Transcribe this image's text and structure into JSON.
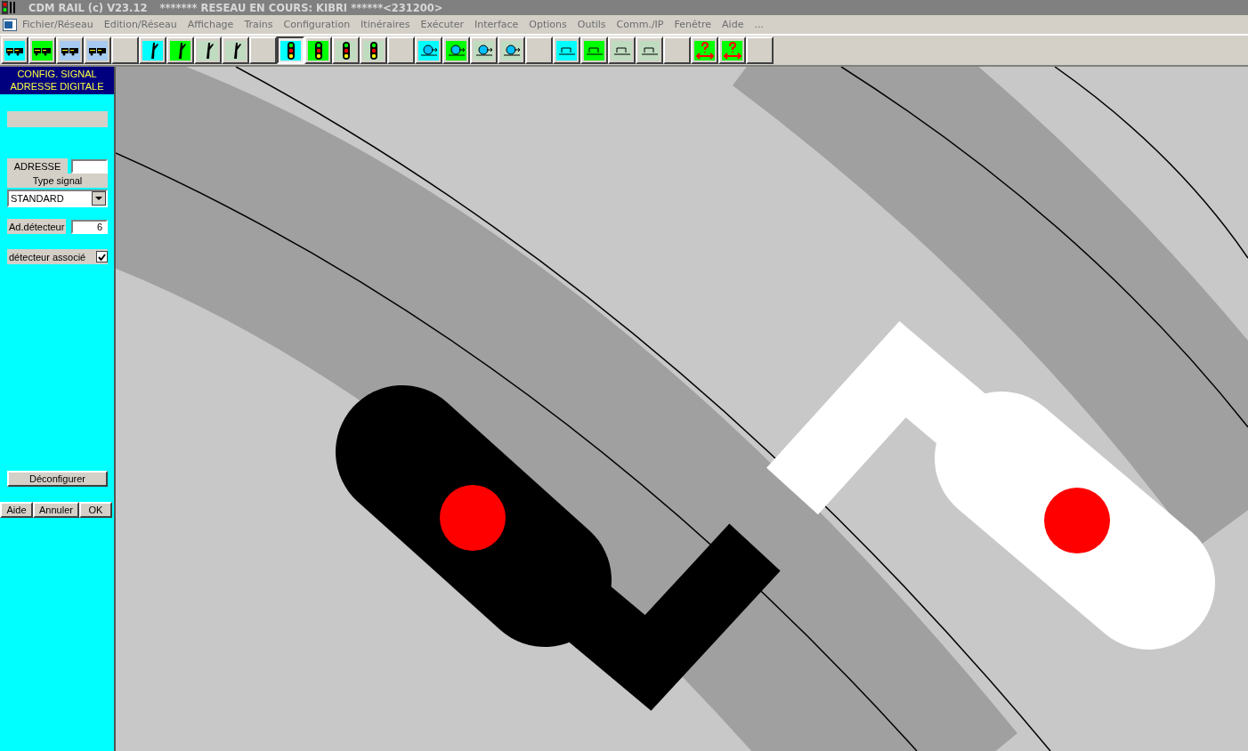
{
  "window": {
    "title": "CDM RAIL (c) V23.12",
    "subtitle": "******* RESEAU EN COURS: KIBRI ******<231200>"
  },
  "menu": [
    "Fichier/Réseau",
    "Edition/Réseau",
    "Affichage",
    "Trains",
    "Configuration",
    "Itinéraires",
    "Exécuter",
    "Interface",
    "Options",
    "Outils",
    "Comm./IP",
    "Fenêtre",
    "Aide",
    "..."
  ],
  "toolbar": [
    {
      "kind": "train",
      "color": "#00ffff",
      "selected": false
    },
    {
      "kind": "train",
      "color": "#00ff00",
      "selected": false
    },
    {
      "kind": "train",
      "color": "#a6caf0",
      "selected": false
    },
    {
      "kind": "train",
      "color": "#a6caf0",
      "selected": false
    },
    {
      "kind": "blank"
    },
    {
      "kind": "switch",
      "color": "#00ffff",
      "selected": false
    },
    {
      "kind": "switch",
      "color": "#00ff00",
      "selected": false
    },
    {
      "kind": "switch",
      "color": "#c0dcc0",
      "selected": false
    },
    {
      "kind": "switch",
      "color": "#c0dcc0",
      "selected": false
    },
    {
      "kind": "blank"
    },
    {
      "kind": "signal",
      "color": "#00ffff",
      "selected": true
    },
    {
      "kind": "signal",
      "color": "#00ff00",
      "selected": false
    },
    {
      "kind": "signal",
      "color": "#c0dcc0",
      "selected": false
    },
    {
      "kind": "signal",
      "color": "#c0dcc0",
      "selected": false
    },
    {
      "kind": "blank"
    },
    {
      "kind": "detector",
      "color": "#00ffff",
      "selected": false
    },
    {
      "kind": "detector",
      "color": "#00ff00",
      "selected": false
    },
    {
      "kind": "detector",
      "color": "#c0dcc0",
      "selected": false
    },
    {
      "kind": "detector",
      "color": "#c0dcc0",
      "selected": false
    },
    {
      "kind": "blank"
    },
    {
      "kind": "buffer",
      "color": "#00ffff",
      "selected": false
    },
    {
      "kind": "buffer",
      "color": "#00ff00",
      "selected": false
    },
    {
      "kind": "buffer",
      "color": "#c0dcc0",
      "selected": false
    },
    {
      "kind": "buffer",
      "color": "#c0dcc0",
      "selected": false
    },
    {
      "kind": "blank"
    },
    {
      "kind": "query",
      "color": "#00ff00",
      "selected": false
    },
    {
      "kind": "query",
      "color": "#00ff00",
      "selected": false
    },
    {
      "kind": "blank"
    }
  ],
  "panel": {
    "heading": [
      "CONFIG. SIGNAL",
      "ADRESSE DIGITALE"
    ],
    "address_label": "ADRESSE",
    "type_label": "Type signal",
    "type_value": "STANDARD",
    "detector_label": "Ad.détecteur",
    "detector_value": "6",
    "associated_label": "détecteur associé",
    "associated_checked": true,
    "unconfigure": "Déconfigurer",
    "buttons": [
      "Aide",
      "Annuler",
      "OK"
    ]
  }
}
